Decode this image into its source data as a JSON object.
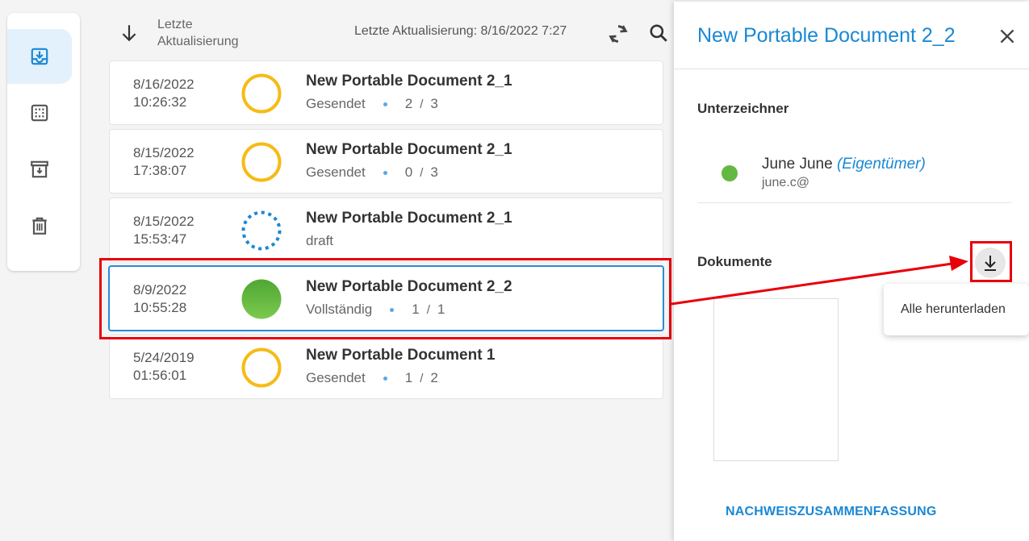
{
  "toolbar": {
    "sort_label": "Letzte Aktualisierung",
    "updated_text": "Letzte Aktualisierung:  8/16/2022 7:27"
  },
  "rail": {
    "items": [
      {
        "icon": "inbox-download-icon",
        "active": true
      },
      {
        "icon": "grid-dots-icon",
        "active": false
      },
      {
        "icon": "archive-icon",
        "active": false
      },
      {
        "icon": "trash-icon",
        "active": false
      }
    ]
  },
  "documents": [
    {
      "date": "8/16/2022",
      "time": "10:26:32",
      "title": "New Portable Document 2_1",
      "status": "Gesendet",
      "signed": "2",
      "total": "3",
      "status_icon": "pending-ring-icon"
    },
    {
      "date": "8/15/2022",
      "time": "17:38:07",
      "title": "New Portable Document 2_1",
      "status": "Gesendet",
      "signed": "0",
      "total": "3",
      "status_icon": "pending-ring-icon"
    },
    {
      "date": "8/15/2022",
      "time": "15:53:47",
      "title": "New Portable Document 2_1",
      "status": "draft",
      "signed": "",
      "total": "",
      "status_icon": "draft-dashed-ring-icon"
    },
    {
      "date": "8/9/2022",
      "time": "10:55:28",
      "title": "New Portable Document 2_2",
      "status": "Vollständig",
      "signed": "1",
      "total": "1",
      "status_icon": "complete-filled-circle-icon"
    },
    {
      "date": "5/24/2019",
      "time": "01:56:01",
      "title": "New Portable Document 1",
      "status": "Gesendet",
      "signed": "1",
      "total": "2",
      "status_icon": "pending-ring-icon"
    }
  ],
  "panel": {
    "title": "New Portable Document 2_2",
    "signers_heading": "Unterzeichner",
    "signer": {
      "name": "June June",
      "role": "(Eigentümer)",
      "email": "june.c@"
    },
    "documents_heading": "Dokumente",
    "download_tooltip": "Alle herunterladen",
    "proof_link": "NACHWEISZUSAMMENFASSUNG"
  },
  "colors": {
    "accent": "#1a88d4",
    "pending": "#f7bb16",
    "complete": "#63b841",
    "annotation": "#e8000a"
  }
}
